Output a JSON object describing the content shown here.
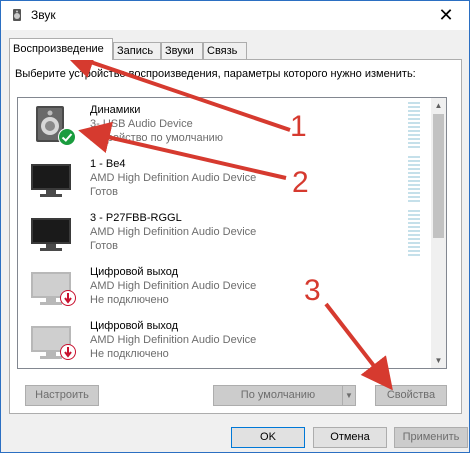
{
  "window": {
    "title": "Звук"
  },
  "tabs": [
    {
      "label": "Воспроизведение",
      "active": true
    },
    {
      "label": "Запись",
      "active": false
    },
    {
      "label": "Звуки",
      "active": false
    },
    {
      "label": "Связь",
      "active": false
    }
  ],
  "instruction": "Выберите устройство воспроизведения, параметры которого нужно изменить:",
  "devices": [
    {
      "name": "Динамики",
      "description": "3- USB Audio Device",
      "status": "Устройство по умолчанию",
      "icon": "speaker-icon",
      "badge": "default-check-icon"
    },
    {
      "name": "1 - Be4",
      "description": "AMD High Definition Audio Device",
      "status": "Готов",
      "icon": "monitor-icon",
      "badge": ""
    },
    {
      "name": "3 - P27FBB-RGGL",
      "description": "AMD High Definition Audio Device",
      "status": "Готов",
      "icon": "monitor-icon",
      "badge": ""
    },
    {
      "name": "Цифровой выход",
      "description": "AMD High Definition Audio Device",
      "status": "Не подключено",
      "icon": "monitor-disabled-icon",
      "badge": "unplugged-icon"
    },
    {
      "name": "Цифровой выход",
      "description": "AMD High Definition Audio Device",
      "status": "Не подключено",
      "icon": "monitor-disabled-icon",
      "badge": "unplugged-icon"
    }
  ],
  "buttons": {
    "configure": "Настроить",
    "set_default": "По умолчанию",
    "properties": "Свойства",
    "ok": "OK",
    "cancel": "Отмена",
    "apply": "Применить"
  },
  "annotations": [
    "1",
    "2",
    "3"
  ],
  "colors": {
    "accent": "#0078d7",
    "arrow": "#d63a2f",
    "check": "#1a9c3e"
  }
}
